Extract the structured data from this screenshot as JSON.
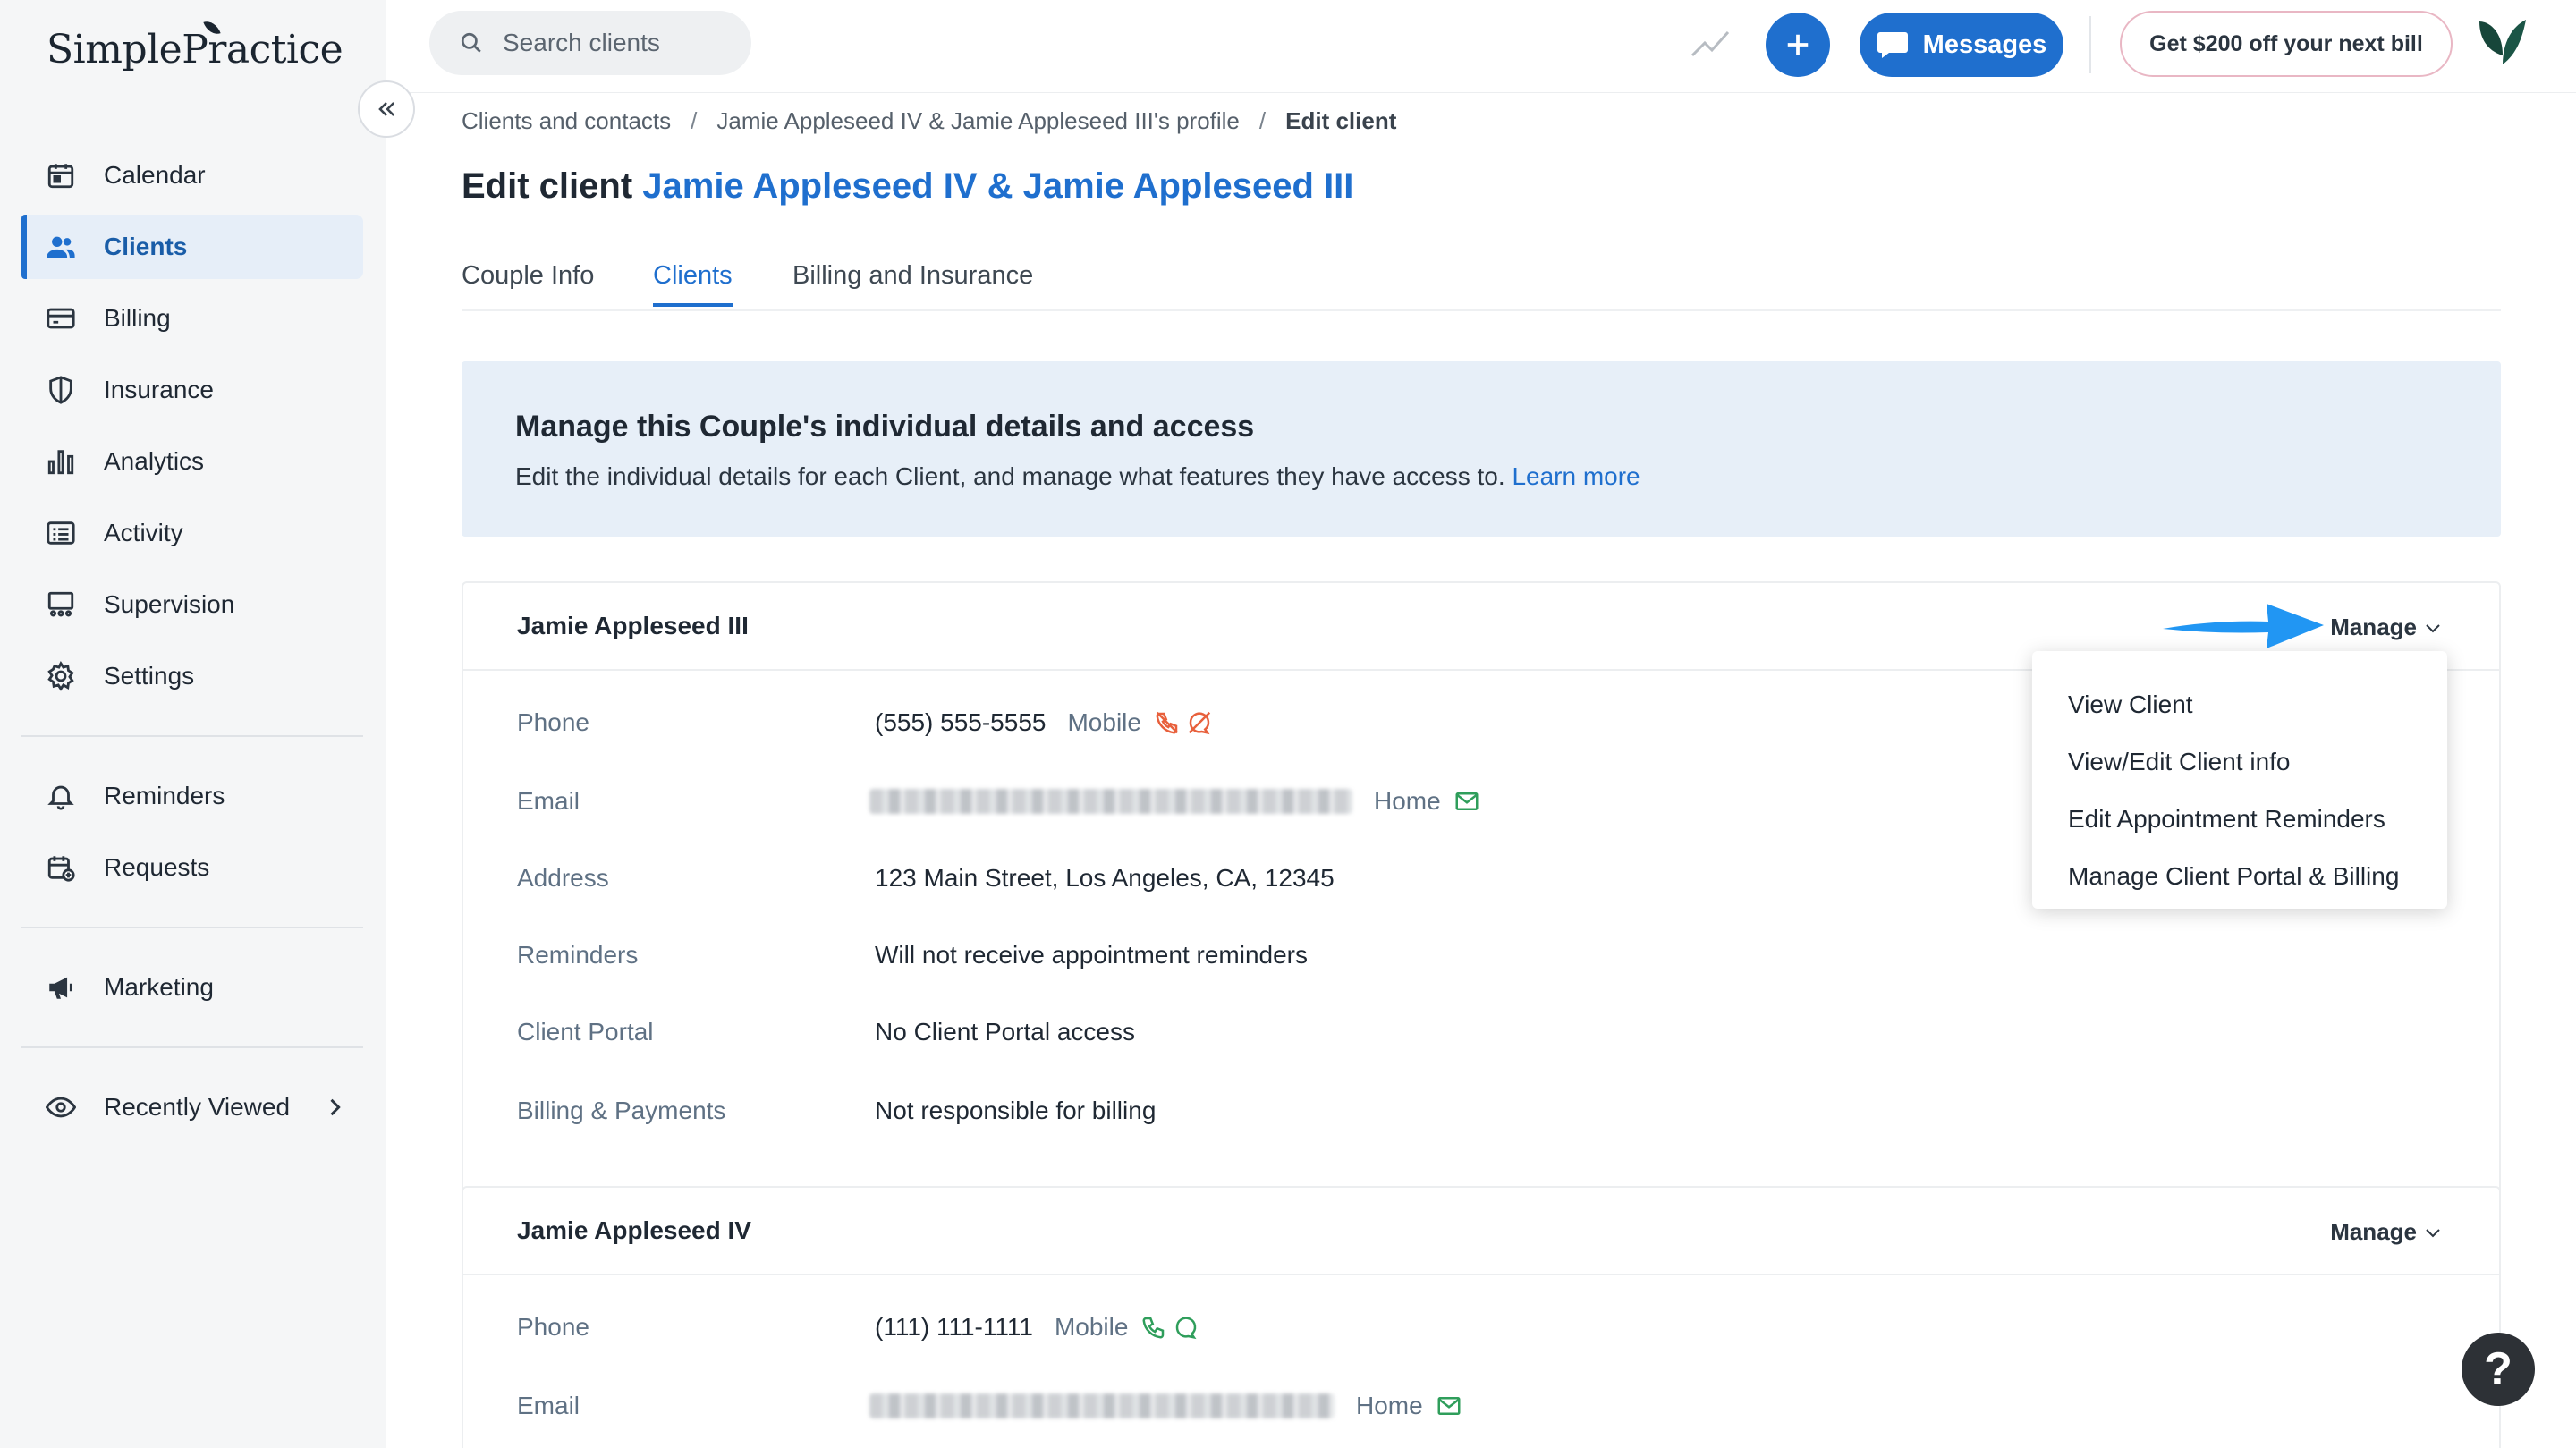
{
  "app": {
    "brand": "SimplePractice"
  },
  "search": {
    "placeholder": "Search clients"
  },
  "topbar": {
    "messages_label": "Messages",
    "promo_label": "Get $200 off your next bill"
  },
  "sidebar": {
    "items": [
      {
        "label": "Calendar",
        "icon": "calendar-icon",
        "active": false
      },
      {
        "label": "Clients",
        "icon": "users-icon",
        "active": true
      },
      {
        "label": "Billing",
        "icon": "credit-card-icon",
        "active": false
      },
      {
        "label": "Insurance",
        "icon": "shield-icon",
        "active": false
      },
      {
        "label": "Analytics",
        "icon": "bar-chart-icon",
        "active": false
      },
      {
        "label": "Activity",
        "icon": "list-icon",
        "active": false
      },
      {
        "label": "Supervision",
        "icon": "supervision-icon",
        "active": false
      },
      {
        "label": "Settings",
        "icon": "gear-icon",
        "active": false
      }
    ],
    "secondary": [
      {
        "label": "Reminders",
        "icon": "bell-icon"
      },
      {
        "label": "Requests",
        "icon": "calendar-plus-icon"
      }
    ],
    "tertiary": [
      {
        "label": "Marketing",
        "icon": "megaphone-icon"
      }
    ],
    "recently_viewed": {
      "label": "Recently Viewed",
      "icon": "eye-icon"
    }
  },
  "breadcrumb": {
    "items": [
      "Clients and contacts",
      "Jamie Appleseed IV & Jamie Appleseed III's profile",
      "Edit client"
    ],
    "separator": "/"
  },
  "page": {
    "title_prefix": "Edit client",
    "title_client": "Jamie Appleseed IV & Jamie Appleseed III"
  },
  "tabs": [
    "Couple Info",
    "Clients",
    "Billing and Insurance"
  ],
  "active_tab": "Clients",
  "banner": {
    "heading": "Manage this Couple's individual details and access",
    "text": "Edit the individual details for each Client, and manage what features they have access to.",
    "link": "Learn more"
  },
  "clients": [
    {
      "name": "Jamie Appleseed III",
      "manage_label": "Manage",
      "fields": {
        "phone_label": "Phone",
        "phone": "(555) 555-5555",
        "phone_type": "Mobile",
        "email_label": "Email",
        "email_type": "Home",
        "address_label": "Address",
        "address": "123 Main Street, Los Angeles, CA, 12345",
        "reminders_label": "Reminders",
        "reminders": "Will not receive appointment reminders",
        "portal_label": "Client Portal",
        "portal": "No Client Portal access",
        "billing_label": "Billing & Payments",
        "billing": "Not responsible for billing"
      }
    },
    {
      "name": "Jamie Appleseed IV",
      "manage_label": "Manage",
      "fields": {
        "phone_label": "Phone",
        "phone": "(111) 111-1111",
        "phone_type": "Mobile",
        "email_label": "Email",
        "email_type": "Home"
      }
    }
  ],
  "manage_menu": [
    "View Client",
    "View/Edit Client info",
    "Edit Appointment Reminders",
    "Manage Client Portal & Billing"
  ],
  "help": {
    "label": "?"
  },
  "colors": {
    "accent": "#1f6fce",
    "banner_bg": "#e7eff8",
    "disabled_icon": "#e8603c",
    "enabled_icon": "#2f9e5b"
  }
}
